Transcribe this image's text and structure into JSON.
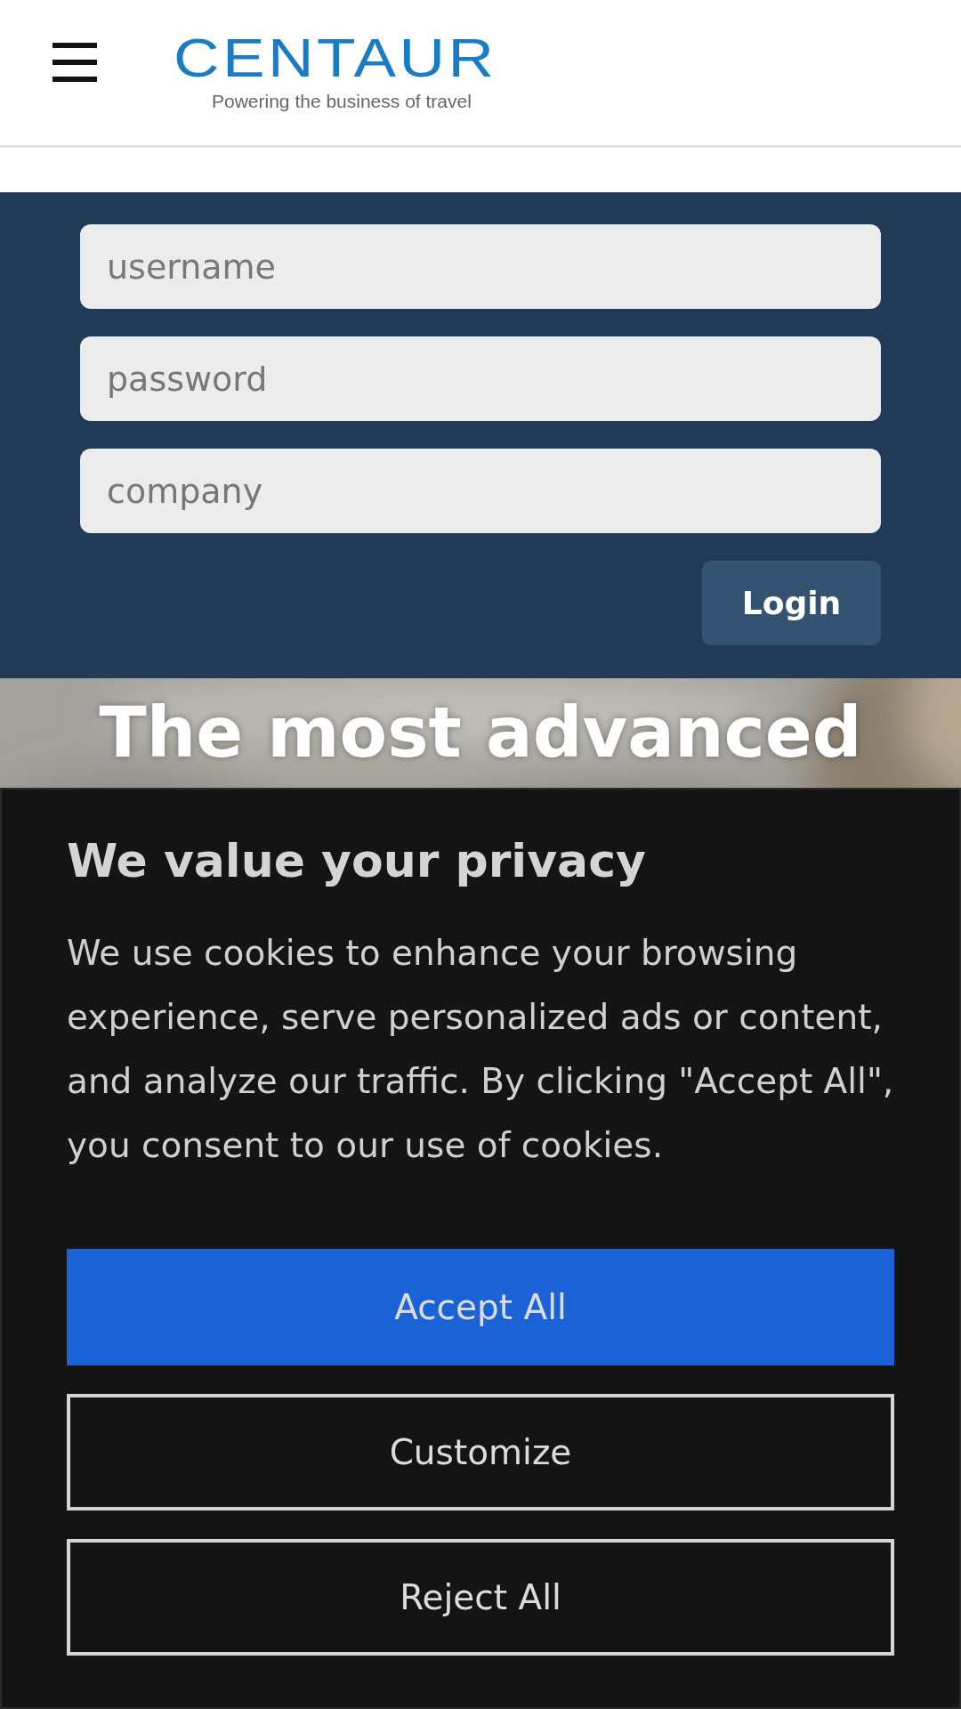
{
  "header": {
    "logo": "CENTAUR",
    "tagline": "Powering the business of travel"
  },
  "login": {
    "fields": [
      {
        "placeholder": "username"
      },
      {
        "placeholder": "password"
      },
      {
        "placeholder": "company"
      }
    ],
    "button": "Login"
  },
  "hero": {
    "kind": "picture",
    "heading": "The most advanced"
  },
  "cookie_banner": {
    "title": "We value your privacy",
    "text": "We use cookies to enhance your browsing experience, serve personalized ads or content, and analyze our traffic. By clicking \"Accept All\", you consent to our use of cookies.",
    "buttons": [
      {
        "label": "Accept All",
        "kind": "primary"
      },
      {
        "label": "Customize",
        "kind": "outline"
      },
      {
        "label": "Reject All",
        "kind": "outline"
      }
    ]
  }
}
